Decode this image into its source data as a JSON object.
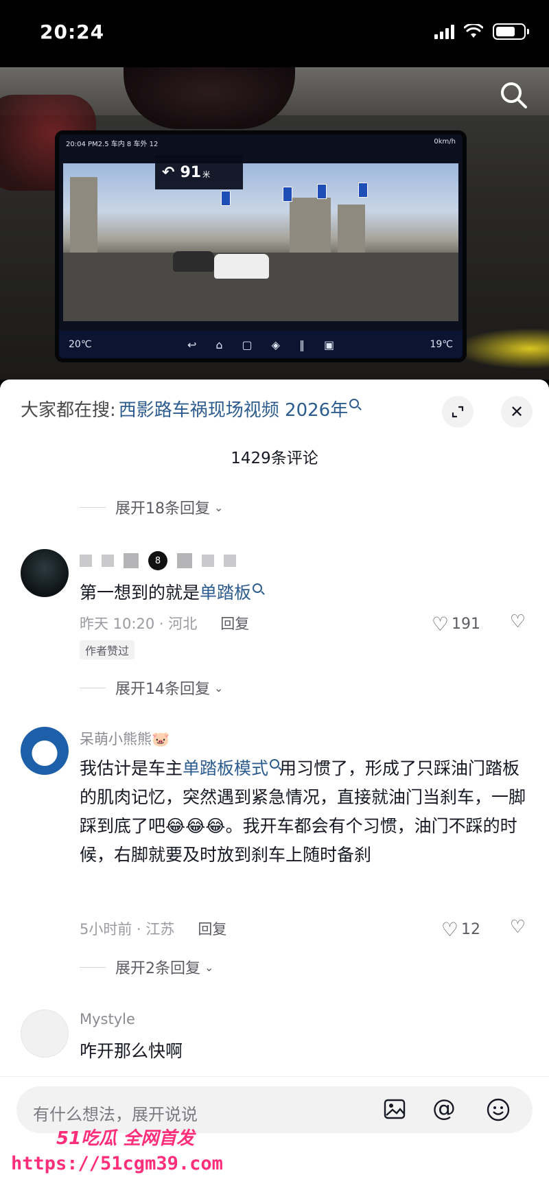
{
  "status_bar": {
    "time": "20:24",
    "battery_level": 0.75
  },
  "video": {
    "screen_top": "20:04 PM2.5 车内 8 车外 12",
    "speed": "0km/h",
    "nav_distance": "91",
    "nav_unit": "米",
    "temp_left": "20℃",
    "temp_right": "19℃",
    "search_icon": "search-icon"
  },
  "hot_search": {
    "prefix": "大家都在搜:",
    "term": "西影路车祸现场视频 2026年"
  },
  "panel_buttons": {
    "expand_icon": "expand-icon",
    "close_icon": "close-icon"
  },
  "comment_count": "1429条评论",
  "expand_replies": [
    {
      "label": "展开18条回复"
    },
    {
      "label": "展开14条回复"
    },
    {
      "label": "展开2条回复"
    }
  ],
  "comments": [
    {
      "username_masked": true,
      "text_before": "第一想到的就是",
      "keyword": "单踏板",
      "text_after": "",
      "time_location": "昨天 10:20 · 河北",
      "reply": "回复",
      "likes": "191",
      "badge": "作者赞过"
    },
    {
      "username": "呆萌小熊熊🐷",
      "text_before": "我估计是车主",
      "keyword": "单踏板模式",
      "text_after": "用习惯了，形成了只踩油门踏板的肌肉记忆，突然遇到紧急情况，直接就油门当刹车，一脚踩到底了吧😂😂😂。我开车都会有个习惯，油门不踩的时候，右脚就要及时放到刹车上随时备刹",
      "time_location": "5小时前 · 江苏",
      "reply": "回复",
      "likes": "12"
    },
    {
      "username": "Mystyle",
      "text_before": "咋开那么快啊",
      "keyword": "",
      "text_after": ""
    }
  ],
  "input": {
    "placeholder": "有什么想法，展开说说"
  },
  "watermark": {
    "brand": "51吃瓜 全网首发",
    "url": "https://51cgm39.com"
  },
  "colors": {
    "keyword": "#2d5c8f",
    "watermark": "#ff2e7a"
  }
}
